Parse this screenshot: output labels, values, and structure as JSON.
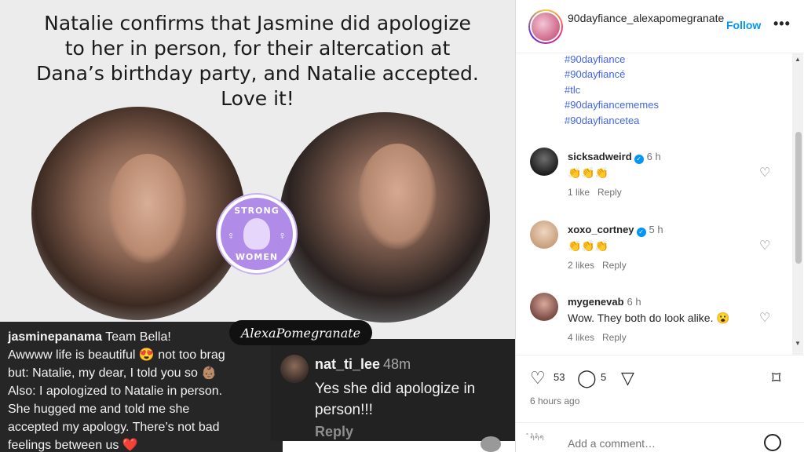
{
  "post_image": {
    "headline_lines": [
      "Natalie confirms that Jasmine did apologize",
      "to her in person, for their altercation at",
      "Dana’s birthday party, and Natalie accepted.",
      "Love it!"
    ],
    "badge": {
      "top": "STRONG",
      "bottom": "WOMEN",
      "venus": "♀"
    },
    "watermark": "AlexaPomegranate",
    "comment_1": {
      "user": "jasminepanama",
      "lines": [
        " Team Bella!",
        "Awwww life is beautiful 😍 not too brag",
        "but: Natalie, my dear, I told you so 👶🏽",
        "Also: I apologized to Natalie in person.",
        "She hugged me and told me she",
        "accepted my apology. There’s not bad",
        "feelings between us ❤️"
      ]
    },
    "comment_2": {
      "user": "nat_ti_lee",
      "time": "48m",
      "text": "Yes she did apologize in person!!!",
      "reply": "Reply"
    }
  },
  "sidebar": {
    "username": "90dayfiance_alexapomegranate",
    "follow_label": "Follow",
    "more_label": "•••",
    "hashtags": [
      "#90dayfiance",
      "#90dayfiancé",
      "#tlc",
      "#90dayfiancememes",
      "#90dayfiancetea"
    ],
    "comments": [
      {
        "user": "sicksadweird",
        "verified": true,
        "time": "6 h",
        "text": "👏👏👏",
        "likes": "1 like",
        "reply": "Reply"
      },
      {
        "user": "xoxo_cortney",
        "verified": true,
        "time": "5 h",
        "text": "👏👏👏",
        "likes": "2 likes",
        "reply": "Reply"
      },
      {
        "user": "mygenevab",
        "verified": false,
        "time": "6 h",
        "text": "Wow. They both do look alike. 😮",
        "likes": "4 likes",
        "reply": "Reply"
      }
    ],
    "actions": {
      "like_count": "53",
      "comment_count": "5"
    },
    "posted": "6 hours ago",
    "add_comment": {
      "placeholder": "Add a comment…",
      "prefix": "ຳຳຳ"
    }
  }
}
